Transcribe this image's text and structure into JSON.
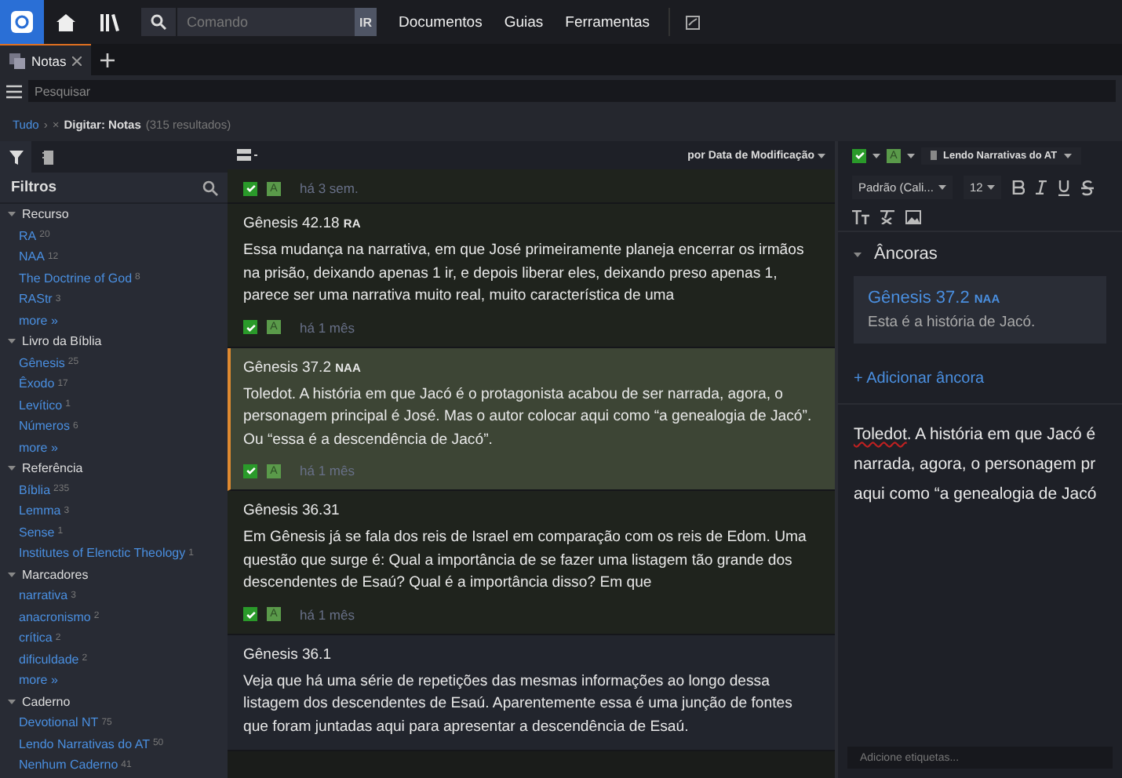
{
  "topbar": {
    "nav": [
      "Documentos",
      "Guias",
      "Ferramentas"
    ],
    "command": {
      "placeholder": "Comando",
      "go": "IR"
    }
  },
  "tabs": [
    {
      "label": "Notas",
      "selected": true
    }
  ],
  "search": {
    "placeholder": "Pesquisar"
  },
  "breadcrumb": {
    "root": "Tudo",
    "separator": "›",
    "remove": "×",
    "filter": "Digitar: Notas",
    "count": "(315 resultados)"
  },
  "sidebar": {
    "tabs": [
      {
        "kind": "filter",
        "selected": true
      },
      {
        "kind": "notebook",
        "selected": false
      }
    ],
    "title": "Filtros",
    "groups": [
      {
        "label": "Recurso",
        "expanded": true,
        "items": [
          {
            "label": "RA",
            "count": "20"
          },
          {
            "label": "NAA",
            "count": "12"
          },
          {
            "label": "The Doctrine of God",
            "count": "8"
          },
          {
            "label": "RAStr",
            "count": "3"
          }
        ],
        "more": "more »"
      },
      {
        "label": "Livro da Bíblia",
        "expanded": true,
        "items": [
          {
            "label": "Gênesis",
            "count": "25"
          },
          {
            "label": "Êxodo",
            "count": "17"
          },
          {
            "label": "Levítico",
            "count": "1"
          },
          {
            "label": "Números",
            "count": "6"
          }
        ],
        "more": "more »"
      },
      {
        "label": "Referência",
        "expanded": true,
        "items": [
          {
            "label": "Bíblia",
            "count": "235"
          },
          {
            "label": "Lemma",
            "count": "3"
          },
          {
            "label": "Sense",
            "count": "1"
          },
          {
            "label": "Institutes of Elenctic Theology",
            "count": "1"
          }
        ]
      },
      {
        "label": "Marcadores",
        "expanded": true,
        "items": [
          {
            "label": "narrativa",
            "count": "3"
          },
          {
            "label": "anacronismo",
            "count": "2"
          },
          {
            "label": "crítica",
            "count": "2"
          },
          {
            "label": "dificuldade",
            "count": "2"
          }
        ],
        "more": "more »"
      },
      {
        "label": "Caderno",
        "expanded": true,
        "items": [
          {
            "label": "Devotional NT",
            "count": "75"
          },
          {
            "label": "Lendo Narrativas do AT",
            "count": "50"
          },
          {
            "label": "Nenhum Caderno",
            "count": "41"
          }
        ]
      }
    ]
  },
  "list": {
    "sort": "por Data de Modificação",
    "notes": [
      {
        "tinted": true,
        "selected": false,
        "checked": true,
        "tag": "A",
        "time": "há 3 sem."
      },
      {
        "tinted": true,
        "selected": false,
        "reference": "Gênesis 42.18",
        "version": "RA",
        "body": "Essa mudança na narrativa, em que José primeiramente planeja encerrar os irmãos na prisão, deixando apenas 1 ir, e depois liberar eles, deixando preso apenas 1, parece ser uma narrativa muito real, muito característica de uma",
        "checked": true,
        "tag": "A",
        "time": "há 1 mês"
      },
      {
        "tinted": true,
        "selected": true,
        "reference": "Gênesis 37.2",
        "version": "NAA",
        "body": "Toledot. A história em que Jacó é o protagonista acabou de ser narrada, agora, o personagem principal é José. Mas o autor colocar aqui como “a genealogia de Jacó”. Ou “essa é a descendência de Jacó”.",
        "checked": true,
        "tag": "A",
        "time": "há 1 mês"
      },
      {
        "tinted": true,
        "selected": false,
        "reference": "Gênesis 36.31",
        "body": "Em Gênesis já se fala dos reis de Israel em comparação com os reis de Edom. Uma questão que surge é: Qual a importância de se fazer uma listagem tão grande dos descendentes de Esaú? Qual é a importância disso? Em que",
        "checked": true,
        "tag": "A",
        "time": "há 1 mês"
      },
      {
        "tinted": false,
        "selected": false,
        "reference": "Gênesis 36.1",
        "body": "Veja que há uma série de repetições das mesmas informações ao longo dessa listagem dos descendentes de Esaú. Aparentemente essa é uma junção de fontes que foram juntadas aqui para apresentar a descendência de Esaú."
      }
    ]
  },
  "editor": {
    "checked": true,
    "tag": "A",
    "notebook": "Lendo Narrativas do AT",
    "font": "Padrão (Cali...",
    "size": "12",
    "anchors_title": "Âncoras",
    "anchors_expanded": true,
    "anchor": {
      "reference": "Gênesis 37.2",
      "version": "NAA",
      "text": "Esta é a história de Jacó."
    },
    "add_anchor": "+ Adicionar âncora",
    "misspelled": "Toledot",
    "lines": [
      ". A história em que Jacó é",
      "narrada, agora, o personagem pr",
      "aqui como “a genealogia de Jacó"
    ],
    "tags": {
      "placeholder": "Adicione etiquetas..."
    }
  }
}
